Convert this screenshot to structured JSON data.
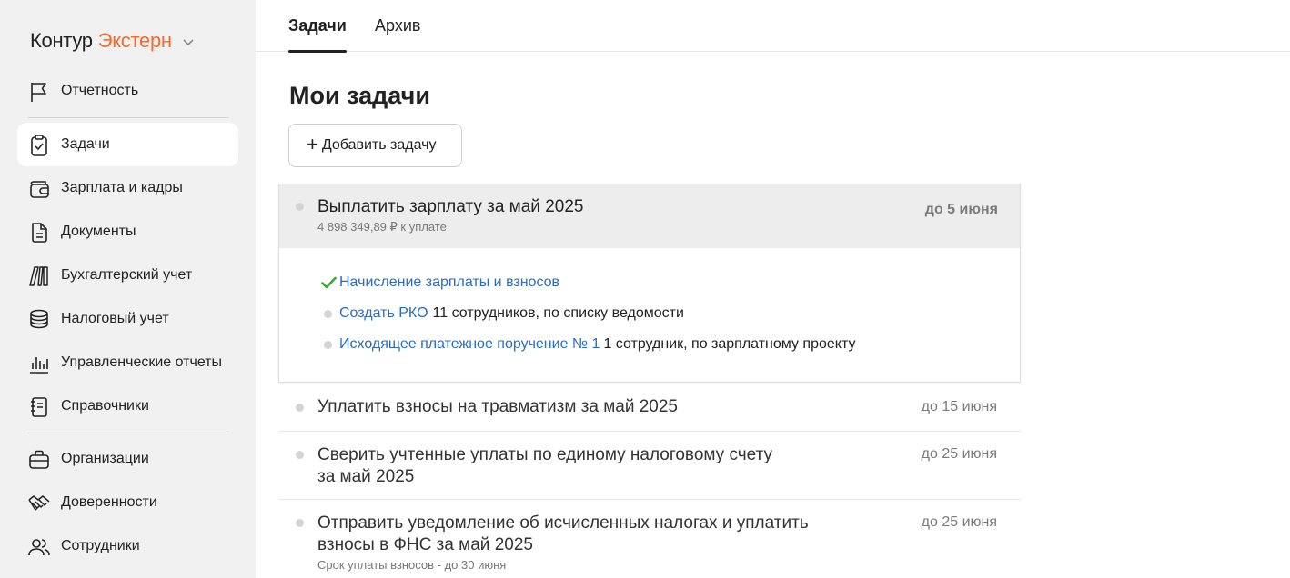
{
  "brand": {
    "part1": "Контур",
    "part2": "Экстерн",
    "accent": "#f86a2b"
  },
  "sidebar": {
    "items": [
      {
        "label": "Отчетность",
        "icon": "flag-icon"
      },
      {
        "label": "Задачи",
        "icon": "clipboard-check-icon",
        "active": true
      },
      {
        "label": "Зарплата и кадры",
        "icon": "wallet-icon"
      },
      {
        "label": "Документы",
        "icon": "document-icon"
      },
      {
        "label": "Бухгалтерский учет",
        "icon": "books-icon"
      },
      {
        "label": "Налоговый учет",
        "icon": "coins-stack-icon"
      },
      {
        "label": "Управленческие отчеты",
        "icon": "bar-chart-icon"
      },
      {
        "label": "Справочники",
        "icon": "notebook-icon"
      },
      {
        "label": "Организации",
        "icon": "briefcase-icon"
      },
      {
        "label": "Доверенности",
        "icon": "handshake-icon"
      },
      {
        "label": "Сотрудники",
        "icon": "users-icon"
      }
    ]
  },
  "tabs": [
    {
      "label": "Задачи",
      "active": true
    },
    {
      "label": "Архив",
      "active": false
    }
  ],
  "main": {
    "title": "Мои задачи",
    "add_button": "Добавить задачу"
  },
  "expanded_task": {
    "title": "Выплатить зарплату за май 2025",
    "subtitle": "4 898 349,89 ₽ к уплате",
    "due": "до 5 июня",
    "subtasks": [
      {
        "link": "Начисление зарплаты и взносов",
        "rest": "",
        "status": "done"
      },
      {
        "link": "Создать РКО",
        "rest": "11 сотрудников, по списку ведомости",
        "status": "pending"
      },
      {
        "link": "Исходящее платежное поручение № 1",
        "rest": "1 сотрудник, по зарплатному проекту",
        "status": "pending"
      }
    ]
  },
  "tasks": [
    {
      "title_line1": "Уплатить взносы на травматизм за май 2025",
      "title_line2": "",
      "due": "до 15 июня",
      "note": ""
    },
    {
      "title_line1": "Сверить учтенные уплаты по единому налоговому счету",
      "title_line2": "за май 2025",
      "due": "до 25 июня",
      "note": ""
    },
    {
      "title_line1": "Отправить уведомление об исчисленных налогах и уплатить",
      "title_line2": "взносы в ФНС за май 2025",
      "due": "до 25 июня",
      "note": "Срок уплаты взносов - до 30 июня"
    }
  ],
  "colors": {
    "link": "#2b6cc4",
    "done_check": "#3aaa35",
    "sidebar_bg": "#f1f1f1"
  }
}
